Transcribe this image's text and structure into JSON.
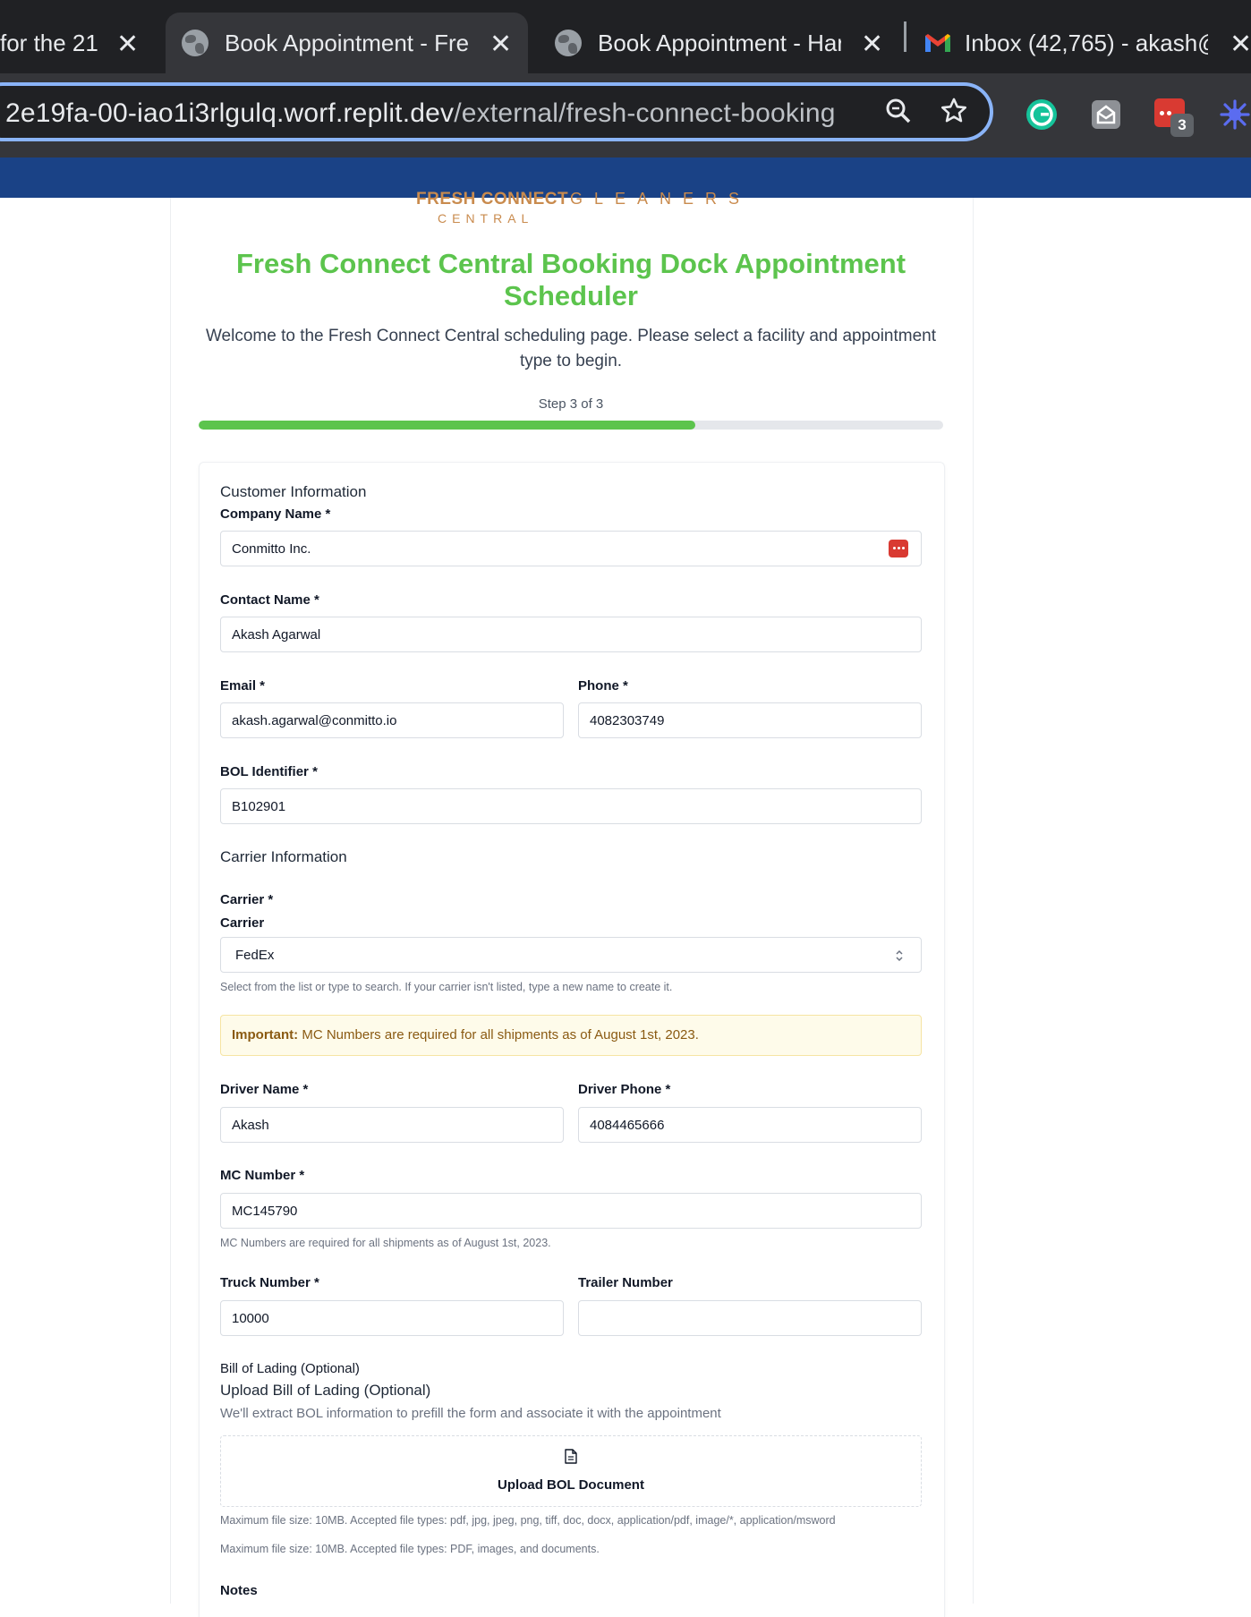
{
  "browser": {
    "tabs": [
      {
        "title": "for the 21",
        "active": false
      },
      {
        "title": "Book Appointment - Fre",
        "active": true
      },
      {
        "title": "Book Appointment - Har",
        "active": false
      },
      {
        "title": "Inbox (42,765) - akash@",
        "active": false
      }
    ],
    "url_host": "2e19fa-00-iao1i3rlgulq.worf.replit.dev",
    "url_path": "/external/fresh-connect-booking",
    "extension_badge": "3"
  },
  "logo": {
    "left_text": "FRESH CONNECT",
    "left_sub": "CENTRAL",
    "right_text": "GLEANERS"
  },
  "header": {
    "title": "Fresh Connect Central Booking Dock Appointment Scheduler",
    "welcome": "Welcome to the Fresh Connect Central scheduling page. Please select a facility and appointment type to begin.",
    "step_text": "Step 3 of 3",
    "progress_percent": 66.7
  },
  "customer": {
    "section_title": "Customer Information",
    "company_label": "Company Name *",
    "company_value": "Conmitto Inc.",
    "contact_label": "Contact Name *",
    "contact_value": "Akash Agarwal",
    "email_label": "Email *",
    "email_value": "akash.agarwal@conmitto.io",
    "phone_label": "Phone *",
    "phone_value": "4082303749",
    "bol_label": "BOL Identifier *",
    "bol_value": "B102901"
  },
  "carrier": {
    "section_title": "Carrier Information",
    "carrier_label": "Carrier *",
    "carrier_sublabel": "Carrier",
    "carrier_value": "FedEx",
    "carrier_help": "Select from the list or type to search. If your carrier isn't listed, type a new name to create it.",
    "alert_strong": "Important:",
    "alert_text": " MC Numbers are required for all shipments as of August 1st, 2023.",
    "driver_name_label": "Driver Name *",
    "driver_name_value": "Akash",
    "driver_phone_label": "Driver Phone *",
    "driver_phone_value": "4084465666",
    "mc_label": "MC Number *",
    "mc_value": "MC145790",
    "mc_help": "MC Numbers are required for all shipments as of August 1st, 2023.",
    "truck_label": "Truck Number *",
    "truck_value": "10000",
    "trailer_label": "Trailer Number",
    "trailer_value": ""
  },
  "bol_upload": {
    "small_title": "Bill of Lading (Optional)",
    "title": "Upload Bill of Lading (Optional)",
    "description": "We'll extract BOL information to prefill the form and associate it with the appointment",
    "button_label": "Upload BOL Document",
    "help1": "Maximum file size: 10MB. Accepted file types: pdf, jpg, jpeg, png, tiff, doc, docx, application/pdf, image/*, application/msword",
    "help2": "Maximum file size: 10MB. Accepted file types: PDF, images, and documents."
  },
  "notes": {
    "label": "Notes"
  }
}
